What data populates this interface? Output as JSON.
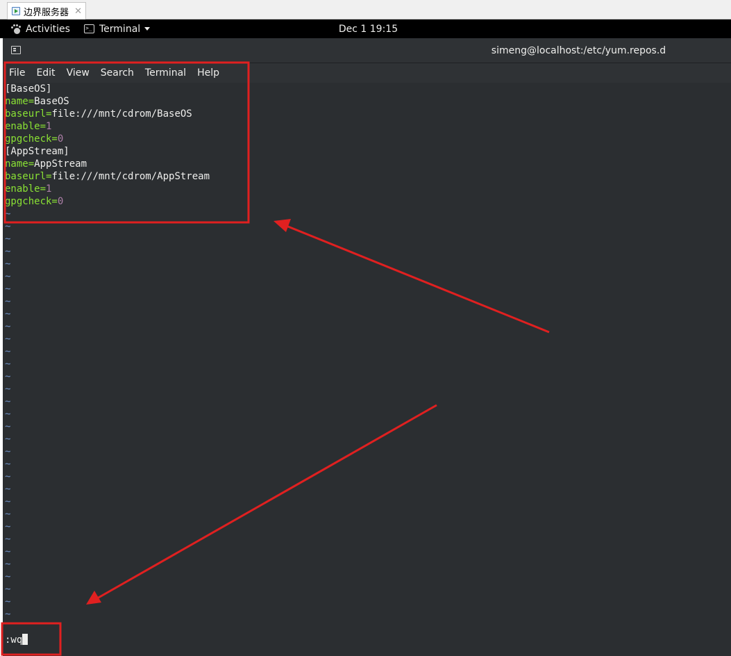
{
  "vm_tab": {
    "title": "边界服务器",
    "close": "✕"
  },
  "topbar": {
    "activities": "Activities",
    "app_menu": "Terminal",
    "clock": "Dec 1  19:15"
  },
  "terminal": {
    "title": "simeng@localhost:/etc/yum.repos.d",
    "menu": [
      "File",
      "Edit",
      "View",
      "Search",
      "Terminal",
      "Help"
    ],
    "lines": [
      {
        "k": "",
        "v": "[BaseOS]"
      },
      {
        "k": "name=",
        "v": "BaseOS"
      },
      {
        "k": "baseurl=",
        "v": "file:///mnt/cdrom/BaseOS"
      },
      {
        "k": "enable=",
        "n": "1"
      },
      {
        "k": "gpgcheck=",
        "n": "0"
      },
      {
        "k": "",
        "v": "[AppStream]"
      },
      {
        "k": "name=",
        "v": "AppStream"
      },
      {
        "k": "baseurl=",
        "v": "file:///mnt/cdrom/AppStream"
      },
      {
        "k": "enable=",
        "n": "1"
      },
      {
        "k": "gpgcheck=",
        "n": "0"
      }
    ],
    "empty_line_marker": "~",
    "command": ":wq"
  },
  "colors": {
    "annotation": "#e02020",
    "keyword": "#8ae234",
    "number": "#ad7fa8",
    "tilde": "#6d8fc2"
  }
}
